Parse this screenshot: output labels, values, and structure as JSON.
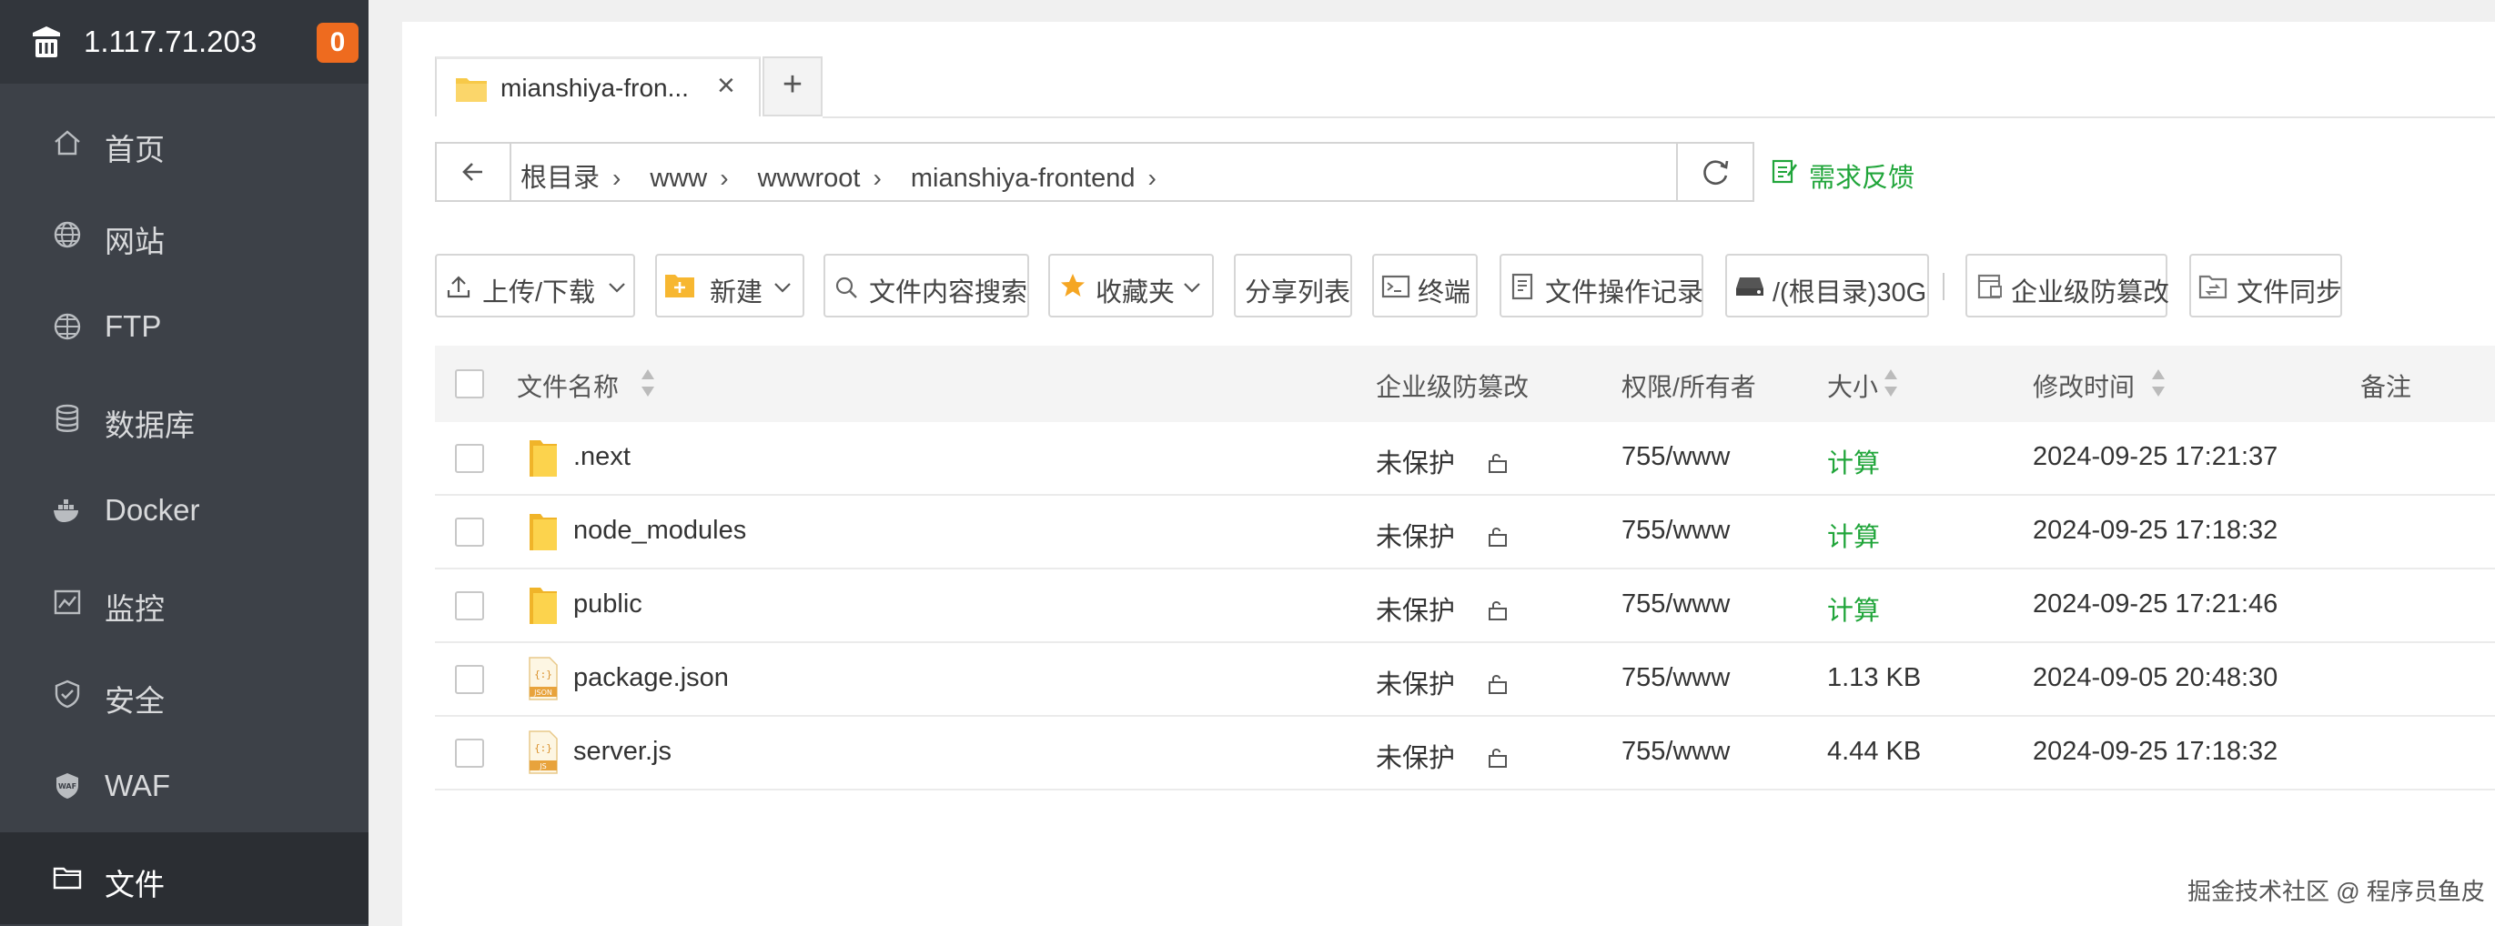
{
  "sidebar": {
    "ip": "1.117.71.203",
    "badge": "0",
    "items": [
      {
        "label": "首页",
        "icon": "home-icon"
      },
      {
        "label": "网站",
        "icon": "globe-icon"
      },
      {
        "label": "FTP",
        "icon": "ftp-icon"
      },
      {
        "label": "数据库",
        "icon": "database-icon"
      },
      {
        "label": "Docker",
        "icon": "docker-icon"
      },
      {
        "label": "监控",
        "icon": "monitor-icon"
      },
      {
        "label": "安全",
        "icon": "shield-icon"
      },
      {
        "label": "WAF",
        "icon": "waf-icon"
      },
      {
        "label": "文件",
        "icon": "folder-icon"
      }
    ],
    "active": "文件"
  },
  "tab": {
    "label": "mianshiya-fron...",
    "close": "×",
    "add": "+"
  },
  "address": {
    "crumbs": [
      "根目录",
      "www",
      "wwwroot",
      "mianshiya-frontend"
    ],
    "separator": "›"
  },
  "feedback": "需求反馈",
  "toolbar": {
    "upload": "上传/下载",
    "new": "新建",
    "search": "文件内容搜索",
    "favorites": "收藏夹",
    "share_list": "分享列表",
    "terminal": "终端",
    "op_log": "文件操作记录",
    "disk": "/(根目录)30G",
    "tamper": "企业级防篡改",
    "sync": "文件同步"
  },
  "table": {
    "headers": {
      "name": "文件名称",
      "tamper": "企业级防篡改",
      "perm": "权限/所有者",
      "size": "大小",
      "mtime": "修改时间",
      "note": "备注"
    },
    "rows": [
      {
        "name": ".next",
        "type": "folder",
        "tamper": "未保护",
        "perm": "755/www",
        "size": "计算",
        "size_is_link": true,
        "mtime": "2024-09-25 17:21:37"
      },
      {
        "name": "node_modules",
        "type": "folder",
        "tamper": "未保护",
        "perm": "755/www",
        "size": "计算",
        "size_is_link": true,
        "mtime": "2024-09-25 17:18:32"
      },
      {
        "name": "public",
        "type": "folder",
        "tamper": "未保护",
        "perm": "755/www",
        "size": "计算",
        "size_is_link": true,
        "mtime": "2024-09-25 17:21:46"
      },
      {
        "name": "package.json",
        "type": "json",
        "tamper": "未保护",
        "perm": "755/www",
        "size": "1.13 KB",
        "size_is_link": false,
        "mtime": "2024-09-05 20:48:30"
      },
      {
        "name": "server.js",
        "type": "js",
        "tamper": "未保护",
        "perm": "755/www",
        "size": "4.44 KB",
        "size_is_link": false,
        "mtime": "2024-09-25 17:18:32"
      }
    ]
  },
  "watermark": "掘金技术社区 @ 程序员鱼皮",
  "colors": {
    "sidebar_bg": "#3d4148",
    "sidebar_head": "#32363c",
    "badge": "#ee6b1f",
    "accent_green": "#20a53a",
    "folder_yellow": "#f7c948"
  }
}
